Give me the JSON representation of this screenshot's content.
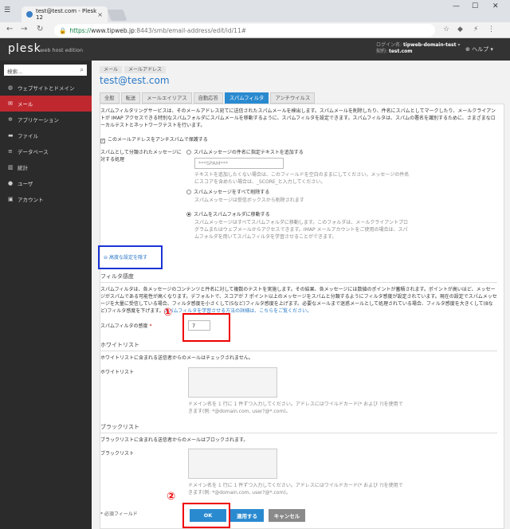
{
  "browser": {
    "tab_title": "test@test.com - Plesk 12",
    "url_secure": "https://",
    "url_host": "www.tipweb.jp",
    "url_path": ":8443/smb/email-address/edit/id/11#"
  },
  "header": {
    "logo": "plesk",
    "logo_sub": "web host edition",
    "login_label": "ログイン名:",
    "login_value": "tipweb-domain-test",
    "contract_label": "契約:",
    "contract_value": "test.com",
    "help": "ヘルプ"
  },
  "sidebar": {
    "search_placeholder": "検索...",
    "items": [
      {
        "label": "ウェブサイトとドメイン"
      },
      {
        "label": "メール"
      },
      {
        "label": "アプリケーション"
      },
      {
        "label": "ファイル"
      },
      {
        "label": "データベース"
      },
      {
        "label": "統計"
      },
      {
        "label": "ユーザ"
      },
      {
        "label": "アカウント"
      }
    ]
  },
  "main": {
    "breadcrumb": [
      "メール",
      "メールアドレス"
    ],
    "title": "test@test.com",
    "tabs": [
      "全般",
      "転送",
      "メールエイリアス",
      "自動応答",
      "スパムフィルタ",
      "アンチウイルス"
    ],
    "intro": "スパムフィルタリングサービスは、そのメールアドレス宛てに送信されたスパムメールを検出します。スパムメールを削除したり、件名にスパムとしてマークしたり、メールクライアントが IMAP アクセスできる特別なスパムフォルダにスパムメールを移動するように、スパムフィルタを設定できます。スパムフィルタは、スパムの署名を識別するために、さまざまなローカルテストとネットワークテストを行います。",
    "enable_label": "このメールアドレスをアンチスパムで保護する",
    "classify_label": "スパムとして分類されたメッセージに対する処理",
    "opt1_label": "スパムメッセージの件名に指定テキストを追加する",
    "opt1_value": "***SPAM***",
    "opt1_hint": "テキストを追加したくない場合は、このフィールドを空白のままにしてください。メッセージの件名にスコアを含めたい場合は、_SCORE_と入力してください。",
    "opt2_label": "スパムメッセージをすべて削除する",
    "opt2_hint": "スパムメッセージは受信ボックスから削除されます",
    "opt3_label": "スパムをスパムフォルダに移動する",
    "opt3_hint": "スパムメッセージはすべてスパムフォルダに移動します。このフォルダは、メールクライアントプログラムまたはウェブメールからアクセスできます。IMAP メールアカウントをご使用の場合は、スパムフォルダを用いてスパムフィルタを学習させることができます。",
    "advanced_link": "高度な設定を隠す",
    "filter_section": "フィルタ感度",
    "filter_desc": "スパムフィルタは、各メッセージのコンテンツと件名に対して複数のテストを実施します。その結果、各メッセージには数値のポイントが蓄積されます。ポイントが高いほど、メッセージがスパムである可能性が高くなります。デフォルトで、スコアが 7 ポイント以上のメッセージをスパムと分類するようにフィルタ感度が設定されています。現在の設定でスパムメッセージを大量に受信している場合、フィルタ感度を小さくして(5など)フィルタ感度を上げます。必要なメールまで迷惑メールとして処理されている場合、フィルタ感度を大きくして(8など)フィルタ感度を下げます。",
    "filter_desc_link": "スパムフィルタを学習させる方法の詳細は、こちらをご覧ください。",
    "sensitivity_label": "スパムフィルタの感度",
    "required_mark": "*",
    "sensitivity_value": "7",
    "whitelist_section": "ホワイトリスト",
    "whitelist_desc": "ホワイトリストに含まれる送信者からのメールはチェックされません。",
    "whitelist_label": "ホワイトリスト",
    "whitelist_hint": "ドメイン名を 1 行に 1 件ずつ入力してください。アドレスにはワイルドカード(* および ?)を使用できます(例: *@domain.com, user?@*.com)。",
    "blacklist_section": "ブラックリスト",
    "blacklist_desc": "ブラックリストに含まれる送信者からのメールはブロックされます。",
    "blacklist_label": "ブラックリスト",
    "blacklist_hint": "ドメイン名を 1 行に 1 件ずつ入力してください。アドレスにはワイルドカード(* および ?)を使用できます(例: *@domain.com, user?@*.com)。",
    "required_note": "* 必須フィールド",
    "ok": "OK",
    "apply": "適用する",
    "cancel": "キャンセル"
  },
  "annotations": {
    "n1": "①",
    "n2": "②"
  },
  "colors": {
    "accent": "#2a8ad0",
    "active_nav": "#c0282f",
    "annotation_red": "#e00000",
    "annotation_blue": "#1b34d6"
  }
}
